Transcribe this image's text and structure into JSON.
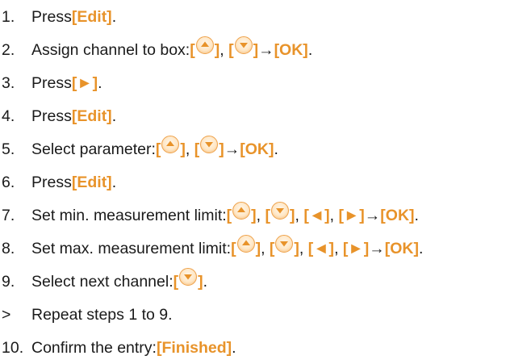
{
  "accent_color": "#e8932a",
  "steps": [
    {
      "num": "1.",
      "text": "Press ",
      "b1": "[Edit]",
      "end": "."
    },
    {
      "num": "2.",
      "text": "Assign channel to box: ",
      "arrow": " → ",
      "ok": "[OK]",
      "end": "."
    },
    {
      "num": "3.",
      "text": "Press ",
      "b1": "[►]",
      "end": "."
    },
    {
      "num": "4.",
      "text": "Press ",
      "b1": "[Edit]",
      "end": "."
    },
    {
      "num": "5.",
      "text": "Select parameter: ",
      "arrow": " → ",
      "ok": "[OK]",
      "end": "."
    },
    {
      "num": "6.",
      "text": "Press ",
      "b1": "[Edit]",
      "end": "."
    },
    {
      "num": "7.",
      "text": "Set min. measurement limit: ",
      "left": "[◄]",
      "right": "[►]",
      "arrow": "→ ",
      "ok": "[OK]",
      "end": "."
    },
    {
      "num": "8.",
      "text": "Set max. measurement limit: ",
      "left": "[◄]",
      "right": "[►]",
      "arrow": "→ ",
      "ok": "[OK]",
      "end": "."
    },
    {
      "num": "9.",
      "text": "Select next channel: ",
      "end": "."
    },
    {
      "num": ">",
      "text": "Repeat steps 1 to 9."
    },
    {
      "num": "10.",
      "text": "Confirm the entry: ",
      "b1": "[Finished]",
      "end": "."
    }
  ],
  "icons": {
    "up": "up-arrow-key-icon",
    "down": "down-arrow-key-icon"
  }
}
